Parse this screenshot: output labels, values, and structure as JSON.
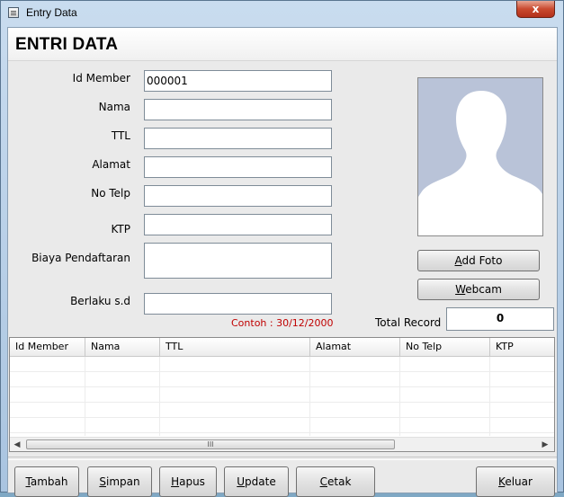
{
  "window": {
    "title": "Entry Data",
    "close_glyph": "x"
  },
  "header": {
    "title": "ENTRI DATA"
  },
  "form": {
    "id_member_label": "Id Member",
    "id_member_value": "000001",
    "nama_label": "Nama",
    "nama_value": "",
    "ttl_label": "TTL",
    "ttl_value": "",
    "alamat_label": "Alamat",
    "alamat_value": "",
    "no_telp_label": "No Telp",
    "no_telp_value": "",
    "ktp_label": "KTP",
    "ktp_value": "",
    "biaya_label": "Biaya Pendaftaran",
    "biaya_value": "",
    "berlaku_label": "Berlaku s.d",
    "berlaku_value": "",
    "date_hint": "Contoh : 30/12/2000"
  },
  "photo": {
    "add_foto_label": "Add Foto",
    "add_foto_mnemonic": "A",
    "add_foto_rest": "dd Foto",
    "webcam_mnemonic": "W",
    "webcam_rest": "ebcam"
  },
  "total": {
    "label": "Total Record",
    "value": "0"
  },
  "grid": {
    "columns": [
      "Id Member",
      "Nama",
      "TTL",
      "Alamat",
      "No Telp",
      "KTP"
    ],
    "rows": [],
    "scroll_thumb": "III"
  },
  "buttons": {
    "tambah": {
      "mnemonic": "T",
      "rest": "ambah"
    },
    "simpan": {
      "mnemonic": "S",
      "rest": "impan"
    },
    "hapus": {
      "mnemonic": "H",
      "rest": "apus"
    },
    "update": {
      "mnemonic": "U",
      "rest": "pdate"
    },
    "cetak": {
      "mnemonic": "C",
      "rest": "etak"
    },
    "keluar": {
      "mnemonic": "K",
      "rest": "eluar"
    }
  },
  "colors": {
    "hint_red": "#c00000",
    "close_red": "#c94a2f",
    "photo_bg": "#b9c3d8"
  },
  "icons": [
    "app-icon",
    "close-icon",
    "avatar-silhouette-icon",
    "scroll-left-icon",
    "scroll-right-icon"
  ]
}
